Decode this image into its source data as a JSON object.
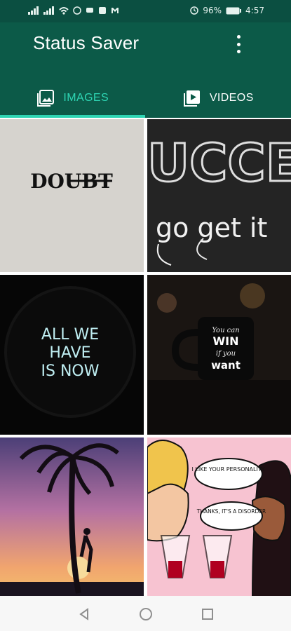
{
  "statusbar": {
    "left_icons": [
      "signal-icon",
      "signal-icon",
      "wifi-icon",
      "whatsapp-icon",
      "message-icon",
      "picture-icon",
      "gmail-icon"
    ],
    "alarm_icon": "alarm-icon",
    "battery_percent": "96%",
    "time": "4:57"
  },
  "appbar": {
    "title": "Status Saver",
    "more_icon": "more-vert-icon"
  },
  "tabs": [
    {
      "label": "IMAGES",
      "icon": "image-icon",
      "active": true
    },
    {
      "label": "VIDEOS",
      "icon": "video-icon",
      "active": false
    }
  ],
  "images": [
    {
      "text": "DOUBT"
    },
    {
      "text_top": "UCCES",
      "text_bottom": "go get it"
    },
    {
      "lines": [
        "ALL WE",
        "HAVE",
        "IS NOW"
      ]
    },
    {
      "lines": [
        "You can",
        "WIN",
        "if you",
        "want"
      ]
    },
    {
      "text": ""
    },
    {
      "bubble1": "I LIKE YOUR PERSONALITY.",
      "bubble2": "THANKS, IT'S A DISORDER"
    }
  ],
  "navbar": {
    "back": "back-icon",
    "home": "home-icon",
    "recent": "recent-apps-icon"
  },
  "colors": {
    "appbar": "#0c5a48",
    "accent": "#2ed5b3"
  }
}
